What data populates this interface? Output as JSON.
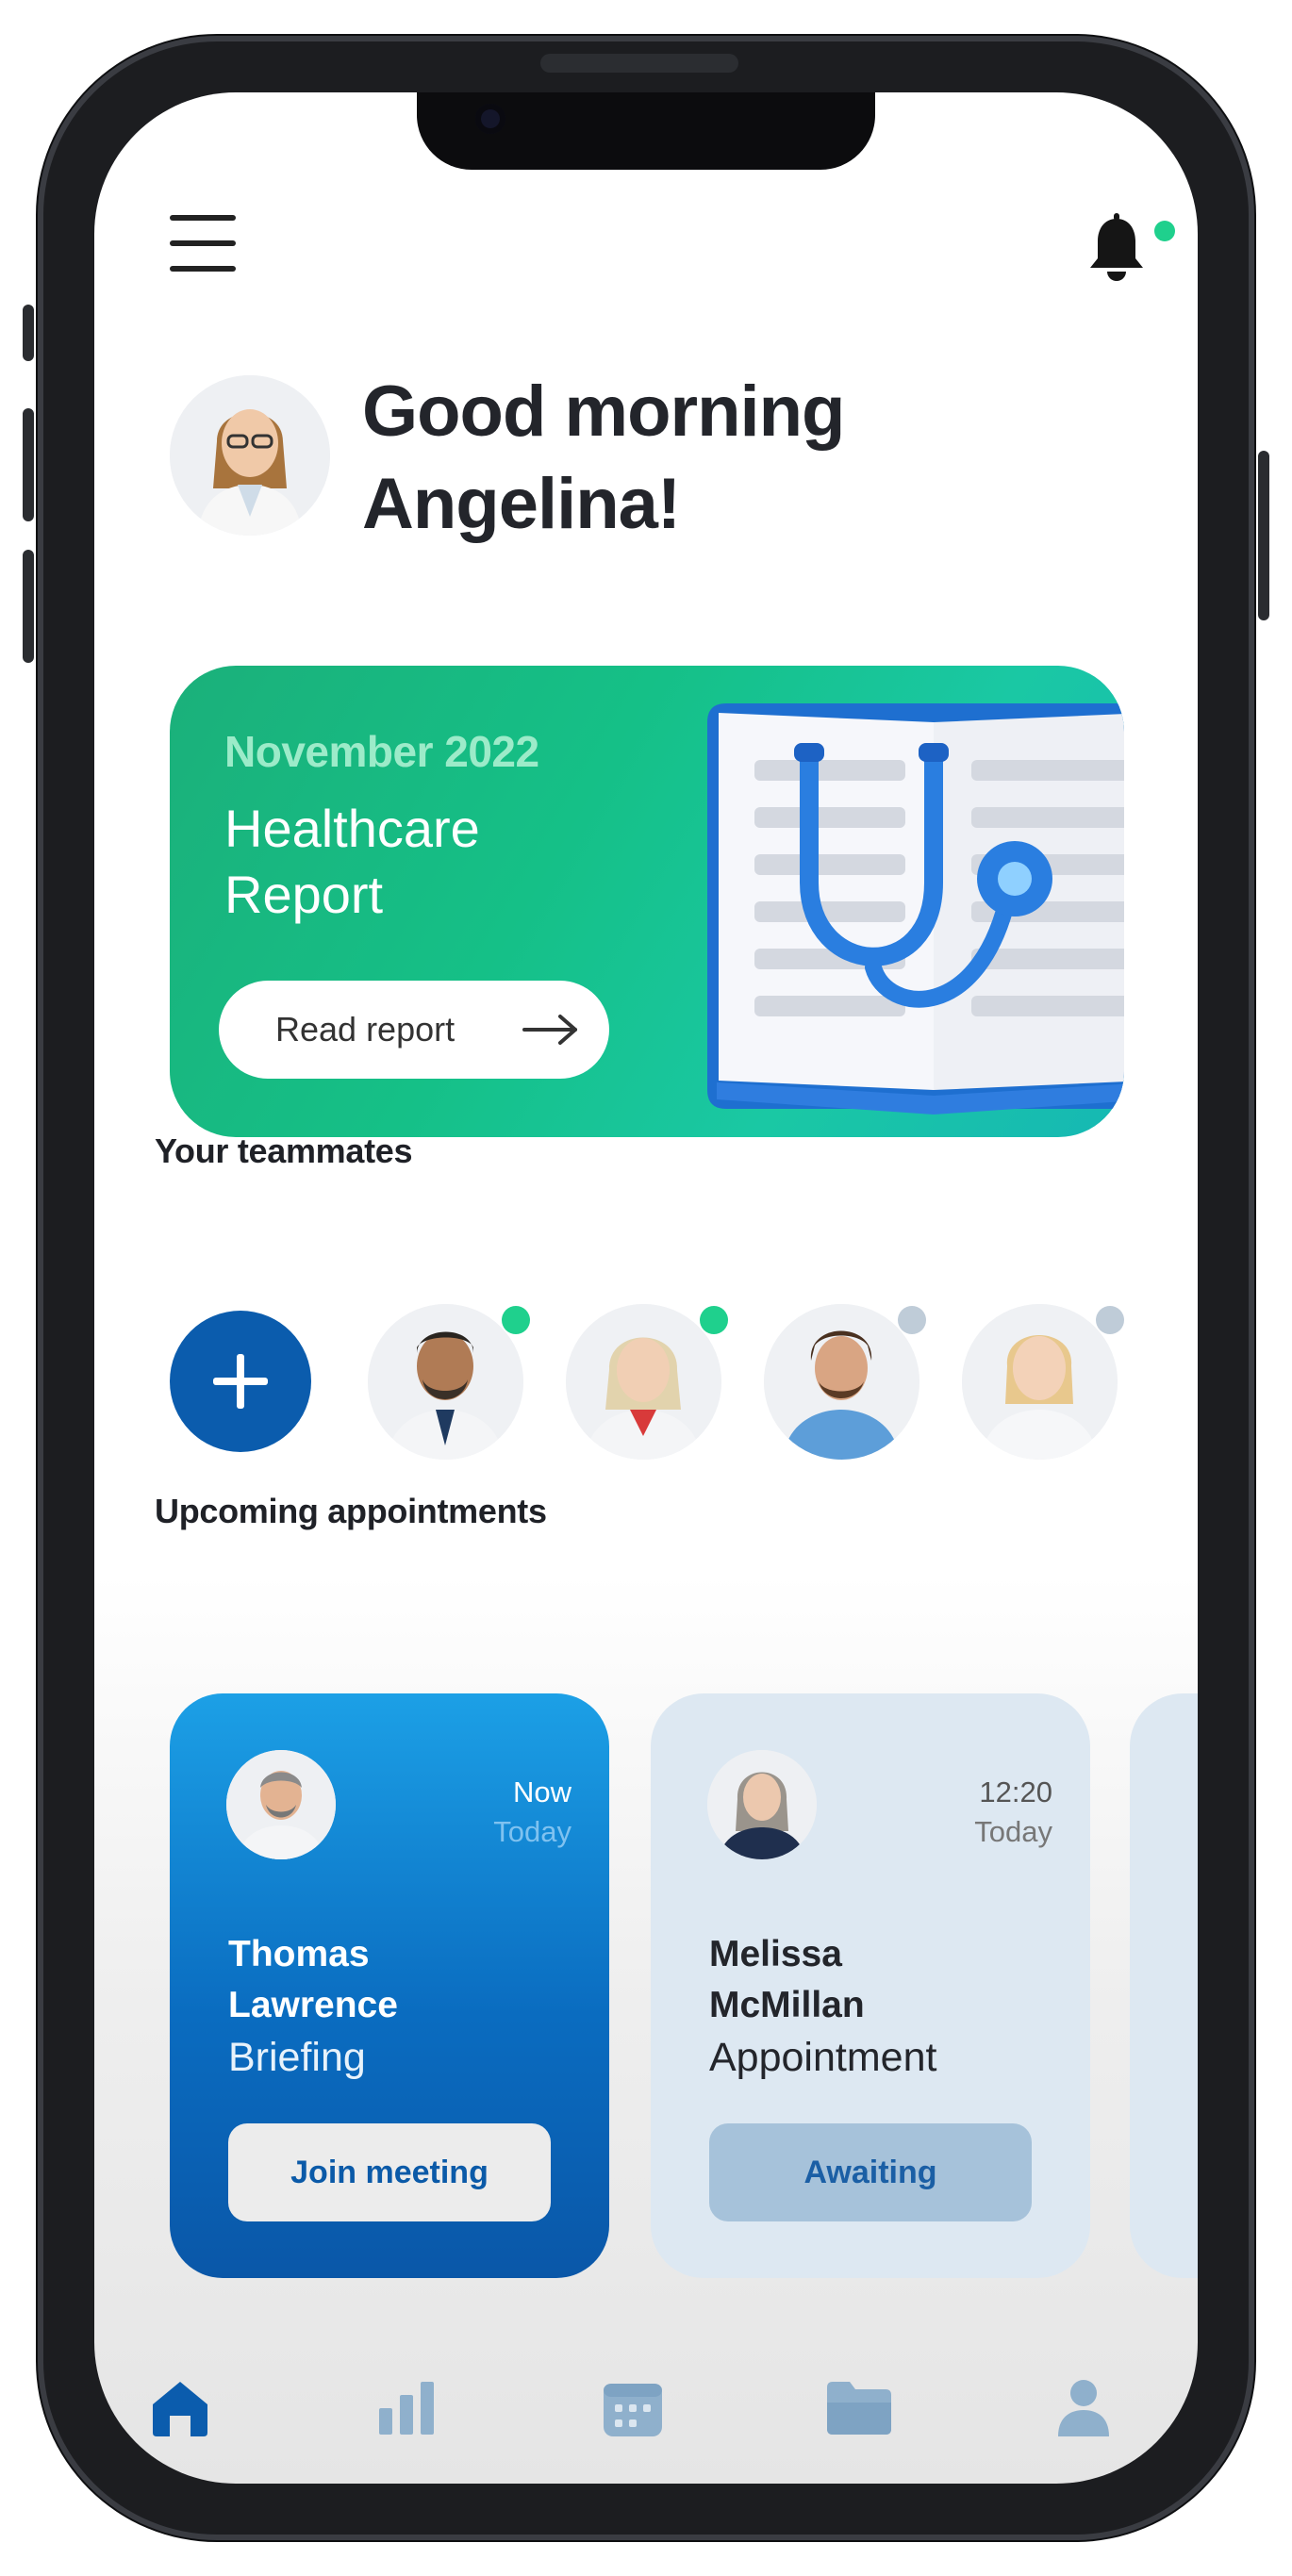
{
  "header": {
    "menu_icon": "hamburger-menu-icon",
    "notification_icon": "bell-icon",
    "notification_dot_color": "#1fd08d"
  },
  "greeting": {
    "line1": "Good morning",
    "line2": "Angelina!"
  },
  "report_card": {
    "date": "November 2022",
    "title_line1": "Healthcare",
    "title_line2": "Report",
    "button_label": "Read report",
    "illustration": "stethoscope-book-illustration"
  },
  "teammates": {
    "title": "Your teammates",
    "add_icon": "plus-icon",
    "members": [
      {
        "status": "online",
        "status_color": "#1fd08d"
      },
      {
        "status": "online",
        "status_color": "#1fd08d"
      },
      {
        "status": "offline",
        "status_color": "#bfccd8"
      },
      {
        "status": "offline",
        "status_color": "#bfccd8"
      }
    ]
  },
  "appointments": {
    "title": "Upcoming appointments",
    "items": [
      {
        "time": "Now",
        "day": "Today",
        "first_name": "Thomas",
        "last_name": "Lawrence",
        "kind": "Briefing",
        "action": "Join meeting"
      },
      {
        "time": "12:20",
        "day": "Today",
        "first_name": "Melissa",
        "last_name": "McMillan",
        "kind": "Appointment",
        "action": "Awaiting"
      }
    ]
  },
  "tabbar": {
    "tabs": [
      {
        "icon": "home-icon",
        "active": true
      },
      {
        "icon": "bar-chart-icon",
        "active": false
      },
      {
        "icon": "calendar-icon",
        "active": false
      },
      {
        "icon": "folder-icon",
        "active": false
      },
      {
        "icon": "profile-icon",
        "active": false
      }
    ],
    "active_color": "#0b5cad",
    "inactive_color": "#8fb0cc"
  }
}
